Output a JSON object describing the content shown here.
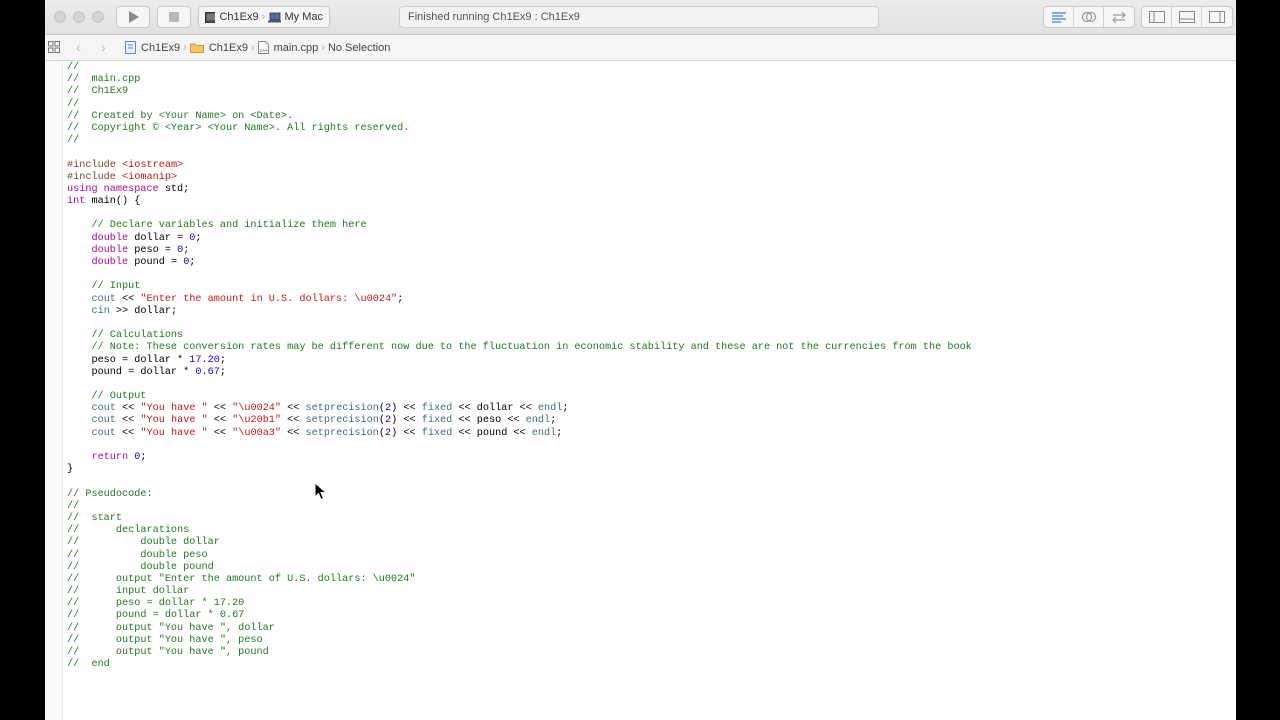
{
  "toolbar": {
    "scheme_target": "Ch1Ex9",
    "scheme_device": "My Mac",
    "activity_status": "Finished running Ch1Ex9 : Ch1Ex9"
  },
  "jumpbar": {
    "crumbs": [
      "Ch1Ex9",
      "Ch1Ex9",
      "main.cpp",
      "No Selection"
    ]
  },
  "editor": {
    "lines": [
      [
        {
          "t": "//",
          "c": "c"
        }
      ],
      [
        {
          "t": "//  main.cpp",
          "c": "c"
        }
      ],
      [
        {
          "t": "//  Ch1Ex9",
          "c": "c"
        }
      ],
      [
        {
          "t": "//",
          "c": "c"
        }
      ],
      [
        {
          "t": "//  Created by <Your Name> on <Date>.",
          "c": "c"
        }
      ],
      [
        {
          "t": "//  Copyright © <Year> <Your Name>. All rights reserved.",
          "c": "c"
        }
      ],
      [
        {
          "t": "//",
          "c": "c"
        }
      ],
      [
        {
          "t": "",
          "c": ""
        }
      ],
      [
        {
          "t": "#include ",
          "c": "p"
        },
        {
          "t": "<iostream>",
          "c": "s"
        }
      ],
      [
        {
          "t": "#include ",
          "c": "p"
        },
        {
          "t": "<iomanip>",
          "c": "s"
        }
      ],
      [
        {
          "t": "using namespace",
          "c": "k"
        },
        {
          "t": " std;",
          "c": ""
        }
      ],
      [
        {
          "t": "int",
          "c": "k"
        },
        {
          "t": " main() {",
          "c": ""
        }
      ],
      [
        {
          "t": "",
          "c": ""
        }
      ],
      [
        {
          "t": "    // Declare variables and initialize them here",
          "c": "c"
        }
      ],
      [
        {
          "t": "    ",
          "c": ""
        },
        {
          "t": "double",
          "c": "k"
        },
        {
          "t": " dollar = ",
          "c": ""
        },
        {
          "t": "0",
          "c": "n"
        },
        {
          "t": ";",
          "c": ""
        }
      ],
      [
        {
          "t": "    ",
          "c": ""
        },
        {
          "t": "double",
          "c": "k"
        },
        {
          "t": " peso = ",
          "c": ""
        },
        {
          "t": "0",
          "c": "n"
        },
        {
          "t": ";",
          "c": ""
        }
      ],
      [
        {
          "t": "    ",
          "c": ""
        },
        {
          "t": "double",
          "c": "k"
        },
        {
          "t": " pound = ",
          "c": ""
        },
        {
          "t": "0",
          "c": "n"
        },
        {
          "t": ";",
          "c": ""
        }
      ],
      [
        {
          "t": "",
          "c": ""
        }
      ],
      [
        {
          "t": "    // Input",
          "c": "c"
        }
      ],
      [
        {
          "t": "    ",
          "c": ""
        },
        {
          "t": "cout",
          "c": "t"
        },
        {
          "t": " << ",
          "c": ""
        },
        {
          "t": "\"Enter the amount in U.S. dollars: \\u0024\"",
          "c": "s"
        },
        {
          "t": ";",
          "c": ""
        }
      ],
      [
        {
          "t": "    ",
          "c": ""
        },
        {
          "t": "cin",
          "c": "t"
        },
        {
          "t": " >> dollar;",
          "c": ""
        }
      ],
      [
        {
          "t": "",
          "c": ""
        }
      ],
      [
        {
          "t": "    // Calculations",
          "c": "c"
        }
      ],
      [
        {
          "t": "    // Note: These conversion rates may be different now due to the fluctuation in economic stability and these are not the currencies from the book",
          "c": "c"
        }
      ],
      [
        {
          "t": "    peso = dollar * ",
          "c": ""
        },
        {
          "t": "17.20",
          "c": "n"
        },
        {
          "t": ";",
          "c": ""
        }
      ],
      [
        {
          "t": "    pound = dollar * ",
          "c": ""
        },
        {
          "t": "0.67",
          "c": "n"
        },
        {
          "t": ";",
          "c": ""
        }
      ],
      [
        {
          "t": "",
          "c": ""
        }
      ],
      [
        {
          "t": "    // Output",
          "c": "c"
        }
      ],
      [
        {
          "t": "    ",
          "c": ""
        },
        {
          "t": "cout",
          "c": "t"
        },
        {
          "t": " << ",
          "c": ""
        },
        {
          "t": "\"You have \"",
          "c": "s"
        },
        {
          "t": " << ",
          "c": ""
        },
        {
          "t": "\"\\u0024\"",
          "c": "s"
        },
        {
          "t": " << ",
          "c": ""
        },
        {
          "t": "setprecision",
          "c": "t"
        },
        {
          "t": "(",
          "c": ""
        },
        {
          "t": "2",
          "c": "n"
        },
        {
          "t": ") << ",
          "c": ""
        },
        {
          "t": "fixed",
          "c": "t"
        },
        {
          "t": " << dollar << ",
          "c": ""
        },
        {
          "t": "endl",
          "c": "t"
        },
        {
          "t": ";",
          "c": ""
        }
      ],
      [
        {
          "t": "    ",
          "c": ""
        },
        {
          "t": "cout",
          "c": "t"
        },
        {
          "t": " << ",
          "c": ""
        },
        {
          "t": "\"You have \"",
          "c": "s"
        },
        {
          "t": " << ",
          "c": ""
        },
        {
          "t": "\"\\u20b1\"",
          "c": "s"
        },
        {
          "t": " << ",
          "c": ""
        },
        {
          "t": "setprecision",
          "c": "t"
        },
        {
          "t": "(",
          "c": ""
        },
        {
          "t": "2",
          "c": "n"
        },
        {
          "t": ") << ",
          "c": ""
        },
        {
          "t": "fixed",
          "c": "t"
        },
        {
          "t": " << peso << ",
          "c": ""
        },
        {
          "t": "endl",
          "c": "t"
        },
        {
          "t": ";",
          "c": ""
        }
      ],
      [
        {
          "t": "    ",
          "c": ""
        },
        {
          "t": "cout",
          "c": "t"
        },
        {
          "t": " << ",
          "c": ""
        },
        {
          "t": "\"You have \"",
          "c": "s"
        },
        {
          "t": " << ",
          "c": ""
        },
        {
          "t": "\"\\u00a3\"",
          "c": "s"
        },
        {
          "t": " << ",
          "c": ""
        },
        {
          "t": "setprecision",
          "c": "t"
        },
        {
          "t": "(",
          "c": ""
        },
        {
          "t": "2",
          "c": "n"
        },
        {
          "t": ") << ",
          "c": ""
        },
        {
          "t": "fixed",
          "c": "t"
        },
        {
          "t": " << pound << ",
          "c": ""
        },
        {
          "t": "endl",
          "c": "t"
        },
        {
          "t": ";",
          "c": ""
        }
      ],
      [
        {
          "t": "",
          "c": ""
        }
      ],
      [
        {
          "t": "    ",
          "c": ""
        },
        {
          "t": "return",
          "c": "k"
        },
        {
          "t": " ",
          "c": ""
        },
        {
          "t": "0",
          "c": "n"
        },
        {
          "t": ";",
          "c": ""
        }
      ],
      [
        {
          "t": "}",
          "c": ""
        }
      ],
      [
        {
          "t": "",
          "c": ""
        }
      ],
      [
        {
          "t": "// Pseudocode:",
          "c": "c"
        }
      ],
      [
        {
          "t": "//",
          "c": "c"
        }
      ],
      [
        {
          "t": "//  start",
          "c": "c"
        }
      ],
      [
        {
          "t": "//      declarations",
          "c": "c"
        }
      ],
      [
        {
          "t": "//          double dollar",
          "c": "c"
        }
      ],
      [
        {
          "t": "//          double peso",
          "c": "c"
        }
      ],
      [
        {
          "t": "//          double pound",
          "c": "c"
        }
      ],
      [
        {
          "t": "//      output \"Enter the amount of U.S. dollars: \\u0024\"",
          "c": "c"
        }
      ],
      [
        {
          "t": "//      input dollar",
          "c": "c"
        }
      ],
      [
        {
          "t": "//      peso = dollar * 17.20",
          "c": "c"
        }
      ],
      [
        {
          "t": "//      pound = dollar * 0.67",
          "c": "c"
        }
      ],
      [
        {
          "t": "//      output \"You have \", dollar",
          "c": "c"
        }
      ],
      [
        {
          "t": "//      output \"You have \", peso",
          "c": "c"
        }
      ],
      [
        {
          "t": "//      output \"You have \", pound",
          "c": "c"
        }
      ],
      [
        {
          "t": "//  end",
          "c": "c"
        }
      ]
    ]
  }
}
